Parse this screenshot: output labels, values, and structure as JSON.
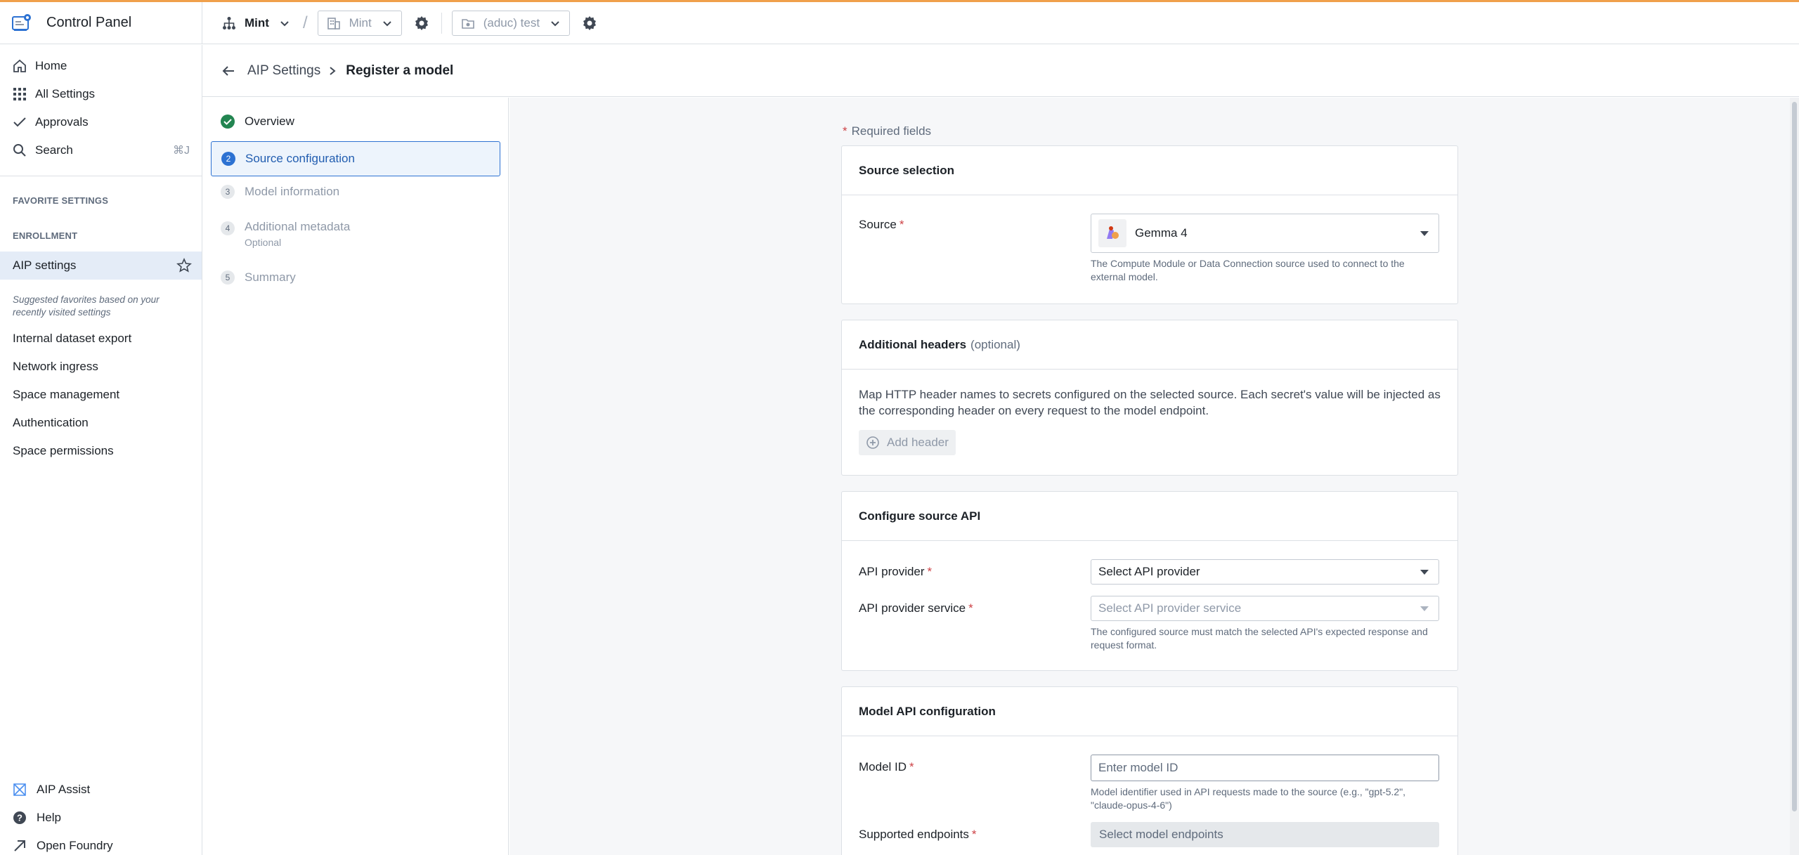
{
  "app": {
    "title": "Control Panel"
  },
  "topbar": {
    "org_label": "Mint",
    "enrollment_label": "Mint",
    "project_label": "(aduc) test"
  },
  "sidebar": {
    "nav": [
      {
        "label": "Home",
        "icon": "home-icon"
      },
      {
        "label": "All Settings",
        "icon": "grid-icon"
      },
      {
        "label": "Approvals",
        "icon": "check-icon"
      },
      {
        "label": "Search",
        "icon": "search-icon",
        "shortcut": "⌘J"
      }
    ],
    "favorite_header": "FAVORITE SETTINGS",
    "enrollment_header": "ENROLLMENT",
    "favorite_item": "AIP settings",
    "hint": "Suggested favorites based on your recently visited settings",
    "suggested": [
      "Internal dataset export",
      "Network ingress",
      "Space management",
      "Authentication",
      "Space permissions"
    ],
    "footer": [
      {
        "label": "AIP Assist",
        "icon": "aip-assist-icon"
      },
      {
        "label": "Help",
        "icon": "help-icon"
      },
      {
        "label": "Open Foundry",
        "icon": "external-link-icon"
      }
    ]
  },
  "breadcrumb": {
    "parent": "AIP Settings",
    "current": "Register a model"
  },
  "steps": [
    {
      "num": "",
      "label": "Overview",
      "state": "done"
    },
    {
      "num": "2",
      "label": "Source configuration",
      "state": "active"
    },
    {
      "num": "3",
      "label": "Model information",
      "state": "pending"
    },
    {
      "num": "4",
      "label": "Additional metadata",
      "sub": "Optional",
      "state": "pending"
    },
    {
      "num": "5",
      "label": "Summary",
      "state": "pending"
    }
  ],
  "form": {
    "required_note": "Required fields",
    "source_selection": {
      "title": "Source selection",
      "source_label": "Source",
      "source_value": "Gemma 4",
      "source_helper": "The Compute Module or Data Connection source used to connect to the external model."
    },
    "additional_headers": {
      "title": "Additional headers",
      "optional": "(optional)",
      "description": "Map HTTP header names to secrets configured on the selected source. Each secret's value will be injected as the corresponding header on every request to the model endpoint.",
      "add_button": "Add header"
    },
    "configure_api": {
      "title": "Configure source API",
      "provider_label": "API provider",
      "provider_value": "Select API provider",
      "service_label": "API provider service",
      "service_value": "Select API provider service",
      "helper": "The configured source must match the selected API's expected response and request format."
    },
    "model_api": {
      "title": "Model API configuration",
      "model_id_label": "Model ID",
      "model_id_placeholder": "Enter model ID",
      "model_id_helper": "Model identifier used in API requests made to the source (e.g., \"gpt-5.2\", \"claude-opus-4-6\")",
      "endpoints_label": "Supported endpoints",
      "endpoints_value": "Select model endpoints"
    }
  },
  "colors": {
    "accent": "#2d72d2",
    "success": "#238551",
    "required": "#cd4246",
    "top_line": "#f0a04b",
    "selected_row": "#e4ecf7"
  }
}
